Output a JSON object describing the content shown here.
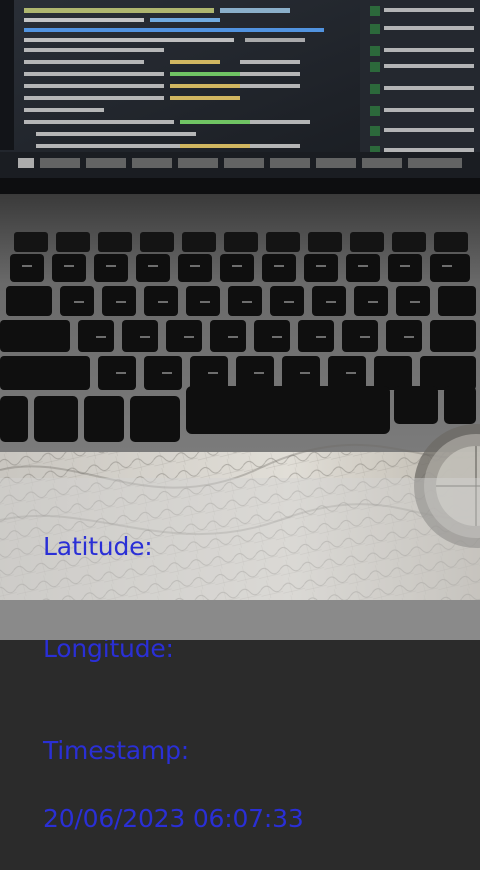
{
  "colors": {
    "overlay_text": "#2a2fd6",
    "screen_bg": "#1f232a",
    "keyboard_deck": "#6d6d6d",
    "key_cap": "#121212",
    "map_paper": "#d8d5cf"
  },
  "overlay": {
    "latitude_label": "Latitude:",
    "longitude_label": "Longitude:",
    "timestamp_label": "Timestamp:",
    "timestamp_value": "20/06/2023 06:07:33"
  }
}
